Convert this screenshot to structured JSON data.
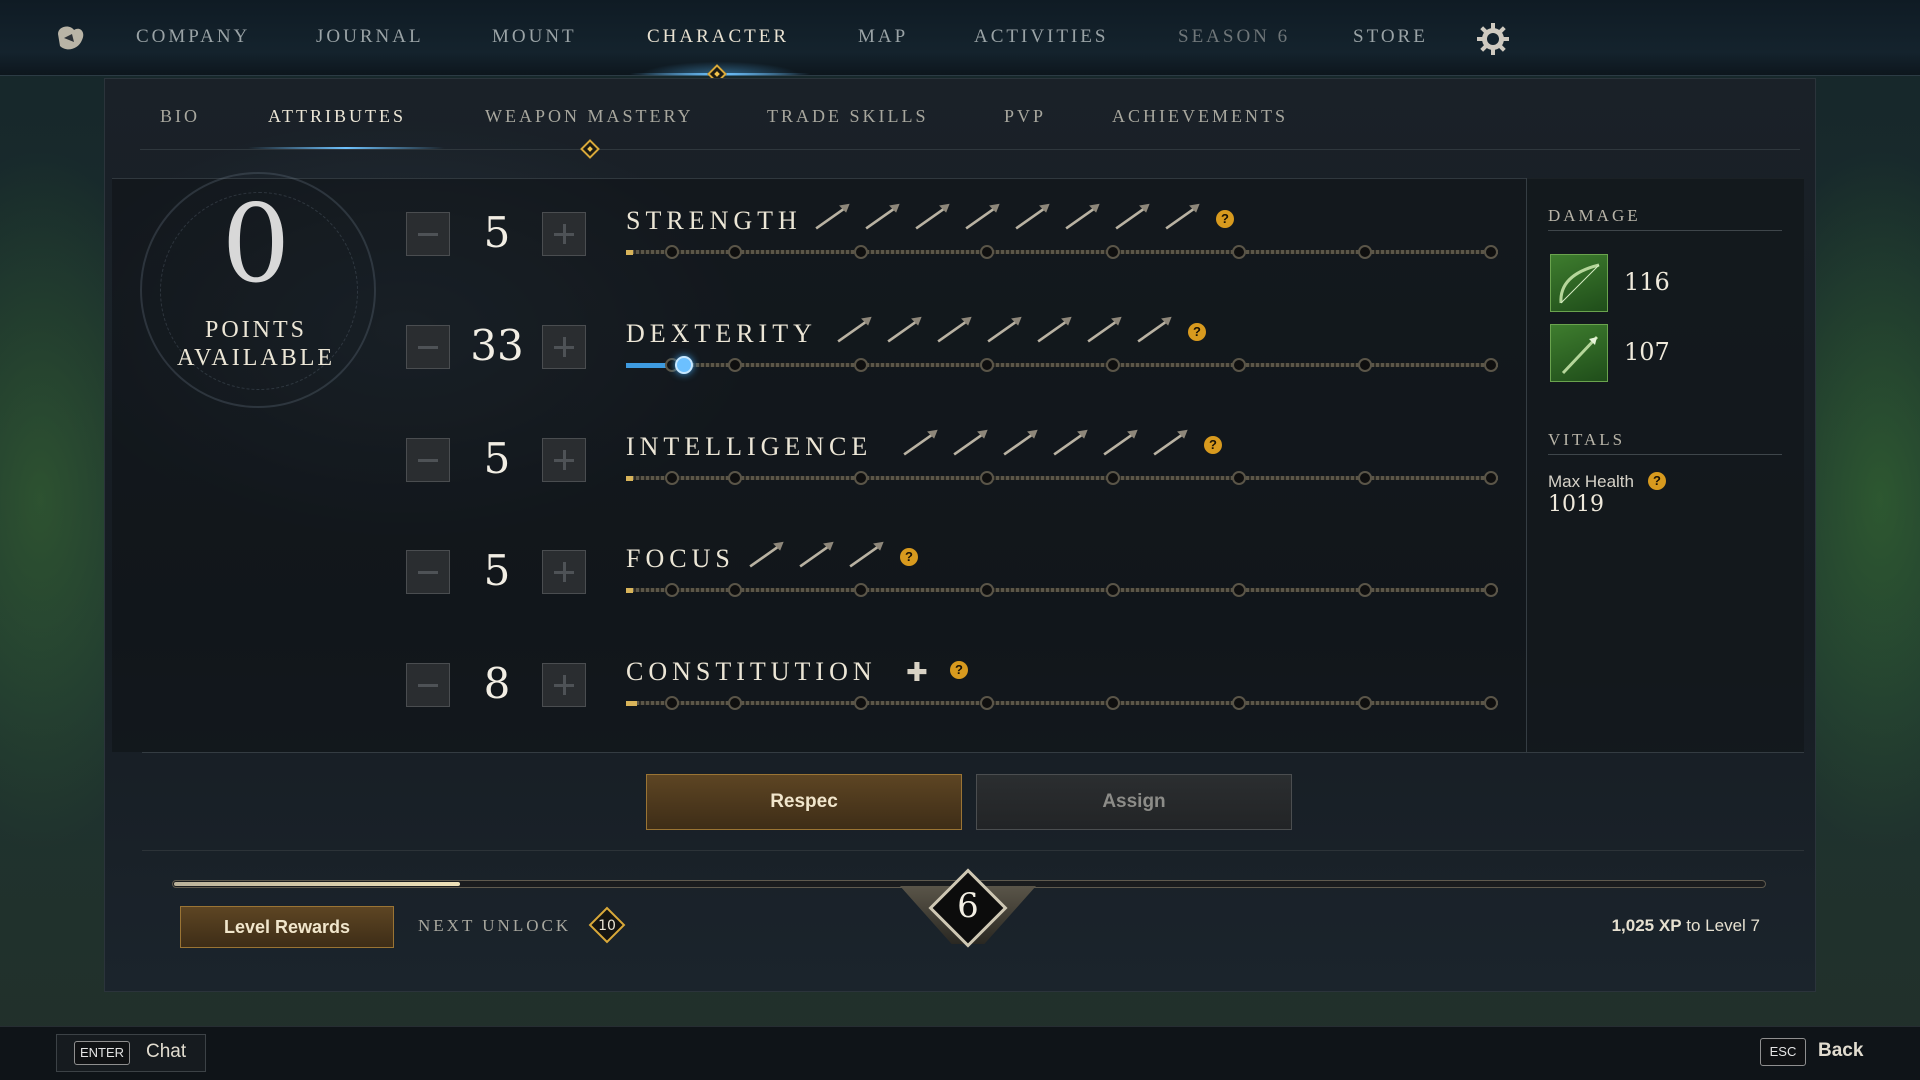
{
  "nav": {
    "items": [
      "COMPANY",
      "JOURNAL",
      "MOUNT",
      "CHARACTER",
      "MAP",
      "ACTIVITIES",
      "SEASON 6",
      "STORE"
    ],
    "active": "CHARACTER",
    "settings_icon": "gear-icon"
  },
  "subnav": {
    "items": [
      "BIO",
      "ATTRIBUTES",
      "WEAPON MASTERY",
      "TRADE SKILLS",
      "PVP",
      "ACHIEVEMENTS"
    ],
    "active": "ATTRIBUTES"
  },
  "points": {
    "value": "0",
    "label_line1": "POINTS",
    "label_line2": "AVAILABLE"
  },
  "attributes": [
    {
      "name": "STRENGTH",
      "value": "5",
      "weapon_icons": 8,
      "track_fill": 0.008
    },
    {
      "name": "DEXTERITY",
      "value": "33",
      "weapon_icons": 7,
      "track_fill": 0.066
    },
    {
      "name": "INTELLIGENCE",
      "value": "5",
      "weapon_icons": 6,
      "track_fill": 0.008
    },
    {
      "name": "FOCUS",
      "value": "5",
      "weapon_icons": 3,
      "track_fill": 0.008
    },
    {
      "name": "CONSTITUTION",
      "value": "8",
      "weapon_icons": 0,
      "track_fill": 0.013
    }
  ],
  "help_glyph": "?",
  "damage": {
    "heading": "DAMAGE",
    "weapons": [
      {
        "icon": "bow-icon",
        "value": "116"
      },
      {
        "icon": "spear-icon",
        "value": "107"
      }
    ]
  },
  "vitals": {
    "heading": "VITALS",
    "max_health_label": "Max Health",
    "max_health_value": "1019"
  },
  "actions": {
    "respec": "Respec",
    "assign": "Assign"
  },
  "level": {
    "current": "6",
    "xp_fraction": 0.18,
    "rewards_button": "Level Rewards",
    "next_unlock_label": "NEXT UNLOCK",
    "next_unlock_value": "10",
    "xp_amount": "1,025 XP",
    "xp_suffix": " to Level 7"
  },
  "footer": {
    "chat_key": "ENTER",
    "chat_label": "Chat",
    "back_key": "ESC",
    "back_label": "Back"
  },
  "colors": {
    "accent_gold": "#d9a93a",
    "active_blue": "#6fc3ff",
    "help_orange": "#d89a1e",
    "weapon_green": "#3e7d2e"
  }
}
